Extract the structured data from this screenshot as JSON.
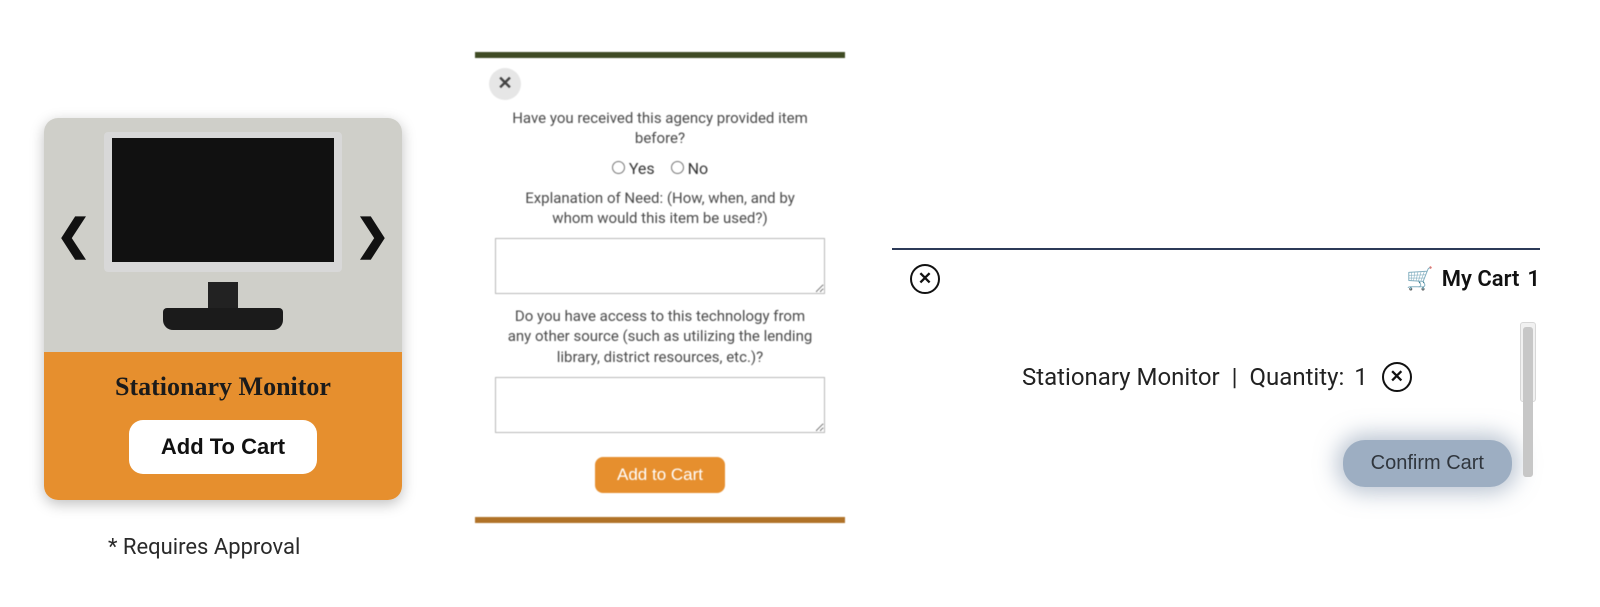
{
  "card": {
    "title": "Stationary Monitor",
    "button": "Add To Cart",
    "approval_note": "* Requires Approval",
    "prev_icon": "chevron-left",
    "next_icon": "chevron-right"
  },
  "form": {
    "q1": "Have you received this agency provided item before?",
    "yes": "Yes",
    "no": "No",
    "q2": "Explanation of Need: (How, when, and by whom would this item be used?)",
    "q2_value": "",
    "q3": "Do you have access to this technology from any other source (such as utilizing the lending library, district resources, etc.)?",
    "q3_value": "",
    "submit": "Add to Cart",
    "close_icon": "x"
  },
  "cart": {
    "close_icon": "x",
    "label": "My Cart",
    "count": "1",
    "item_name": "Stationary Monitor",
    "separator": "|",
    "qty_label": "Quantity:",
    "qty_value": "1",
    "remove_icon": "x",
    "confirm": "Confirm Cart"
  }
}
